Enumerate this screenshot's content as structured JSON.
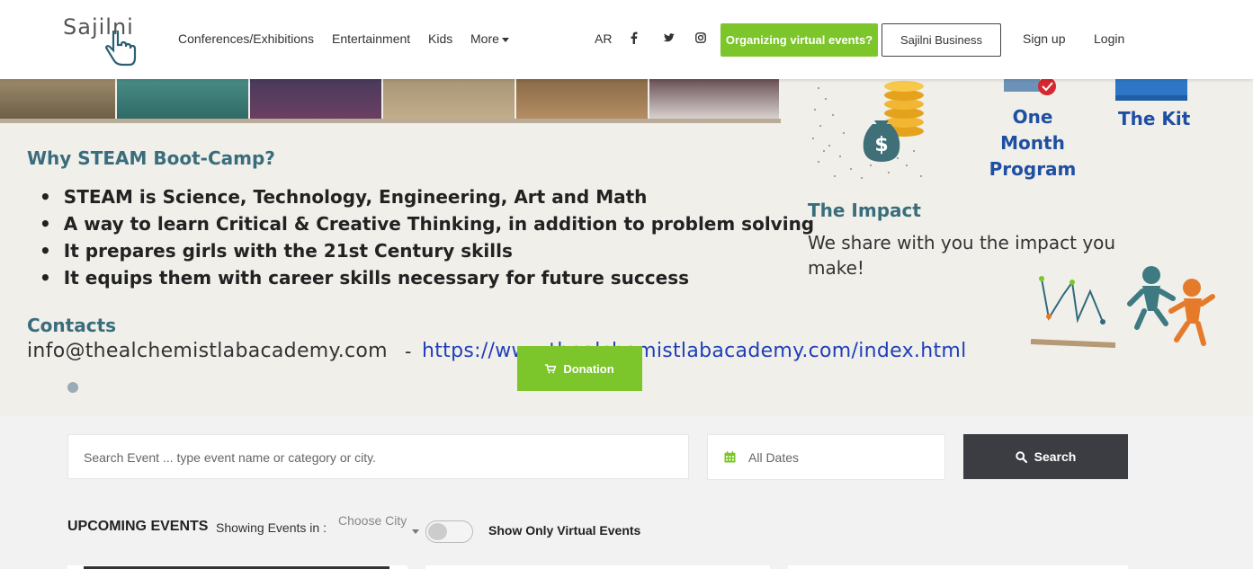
{
  "nav": {
    "logo_text": "Sajilni",
    "links": [
      "Conferences/Exhibitions",
      "Entertainment",
      "Kids",
      "More"
    ],
    "lang": "AR",
    "social_icons": [
      "facebook-icon",
      "twitter-icon",
      "instagram-icon"
    ],
    "organize_label": "Organizing virtual events?",
    "business_label": "Sajilni Business",
    "signup_label": "Sign up",
    "login_label": "Login"
  },
  "banner": {
    "why_title": "Why STEAM Boot-Camp?",
    "bullets": [
      "STEAM is Science, Technology, Engineering, Art and Math",
      "A way to learn Critical & Creative Thinking, in addition to problem solving",
      "It prepares girls with the 21st Century skills",
      "It equips them with career skills necessary for future success"
    ],
    "contacts_title": "Contacts",
    "email": "info@thealchemistlabacademy.com",
    "dash": "-",
    "url": "https://www.thealchemistlabacademy.com/index.html",
    "one_month": "One Month Program",
    "the_kit": "The Kit",
    "impact_title": "The Impact",
    "impact_text": "We share with you the impact you make!",
    "donation_label": "Donation"
  },
  "search": {
    "placeholder": "Search Event ... type event name or category or city.",
    "dates_label": "All Dates",
    "button_label": "Search"
  },
  "upcoming": {
    "title": "UPCOMING EVENTS",
    "showing": "Showing Events in :",
    "city_placeholder": "Choose City",
    "virtual_label": "Show Only Virtual Events",
    "virtual_on": false
  },
  "colors": {
    "green": "#7cc52a",
    "dark": "#3b3d42",
    "teal": "#3a6d7c",
    "link_blue": "#1f3fb8"
  }
}
